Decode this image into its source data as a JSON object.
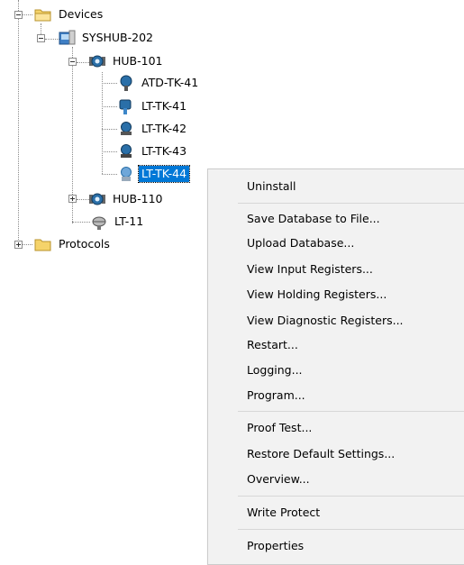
{
  "tree": {
    "devices": "Devices",
    "syshub": "SYSHUB-202",
    "hub101": "HUB-101",
    "atd_tk_41": "ATD-TK-41",
    "lt_tk_41": "LT-TK-41",
    "lt_tk_42": "LT-TK-42",
    "lt_tk_43": "LT-TK-43",
    "lt_tk_44": "LT-TK-44",
    "hub110": "HUB-110",
    "lt_11": "LT-11",
    "protocols": "Protocols"
  },
  "context_menu": {
    "uninstall": "Uninstall",
    "save_database": "Save Database to File...",
    "upload_database": "Upload Database...",
    "view_input_registers": "View Input Registers...",
    "view_holding_registers": "View Holding Registers...",
    "view_diagnostic_registers": "View Diagnostic Registers...",
    "restart": "Restart...",
    "logging": "Logging...",
    "program": "Program...",
    "proof_test": "Proof Test...",
    "restore_defaults": "Restore Default Settings...",
    "overview": "Overview...",
    "write_protect": "Write Protect",
    "properties": "Properties"
  },
  "colors": {
    "selection": "#0078d7",
    "folder": "#f5d36a",
    "device_blue": "#2a6fa8"
  },
  "icons": {
    "devices": "folder-icon",
    "syshub": "hub-computer-icon",
    "hub": "hub-device-icon",
    "transmitter": "transmitter-icon",
    "lt11": "sensor-icon",
    "protocols": "folder-icon"
  }
}
